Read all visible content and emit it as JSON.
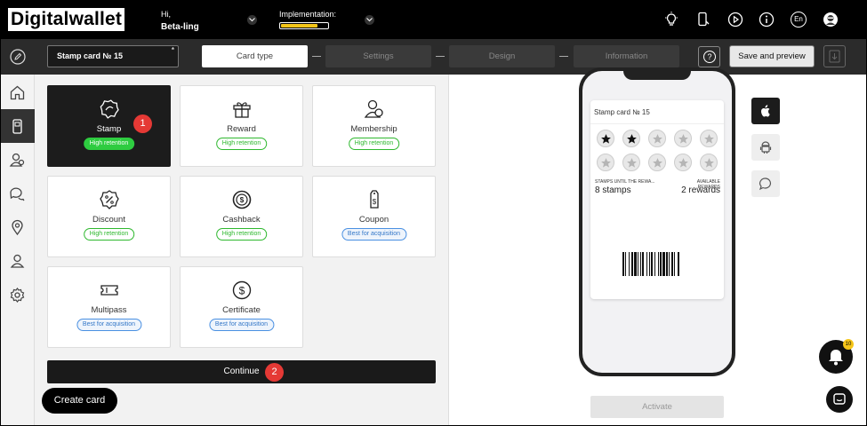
{
  "header": {
    "logo": "Digitalwallet",
    "greeting": "Hi,",
    "user_name": "Beta-ling",
    "implementation_label": "Implementation:",
    "implementation_progress": 0.75,
    "language": "En"
  },
  "toolbar": {
    "card_name": "Stamp card № 15",
    "required_mark": "*",
    "steps": [
      "Card type",
      "Settings",
      "Design",
      "Information"
    ],
    "active_step": 0,
    "help": "?",
    "save_label": "Save and preview"
  },
  "card_types": [
    {
      "label": "Stamp",
      "badge": "High retention",
      "badge_type": "green",
      "icon": "stamp-icon"
    },
    {
      "label": "Reward",
      "badge": "High retention",
      "badge_type": "green",
      "icon": "gift-icon"
    },
    {
      "label": "Membership",
      "badge": "High retention",
      "badge_type": "green",
      "icon": "membership-icon"
    },
    {
      "label": "Discount",
      "badge": "High retention",
      "badge_type": "green",
      "icon": "percent-badge-icon"
    },
    {
      "label": "Cashback",
      "badge": "High retention",
      "badge_type": "green",
      "icon": "cashback-icon"
    },
    {
      "label": "Coupon",
      "badge": "Best for acquisition",
      "badge_type": "blue",
      "icon": "coupon-tag-icon"
    },
    {
      "label": "Multipass",
      "badge": "Best for acquisition",
      "badge_type": "blue",
      "icon": "ticket-icon"
    },
    {
      "label": "Certificate",
      "badge": "Best for acquisition",
      "badge_type": "blue",
      "icon": "dollar-circle-icon"
    }
  ],
  "selected_card_type": "Stamp",
  "markers": {
    "one": "1",
    "two": "2"
  },
  "continue_label": "Continue",
  "create_card_label": "Create card",
  "preview": {
    "card_title": "Stamp card № 15",
    "stamps_filled": 2,
    "stamps_total": 10,
    "stamps_label": "STAMPS UNTIL THE REWA...",
    "stamps_value": "8 stamps",
    "rewards_label": "AVAILABLE REWARDS",
    "rewards_value": "2 rewards",
    "activate_label": "Activate"
  },
  "notifications_count": "10",
  "colors": {
    "accent_green": "#2ecc40",
    "marker_red": "#e53935",
    "progress_yellow": "#f5c518",
    "dark": "#1c1c1c"
  }
}
